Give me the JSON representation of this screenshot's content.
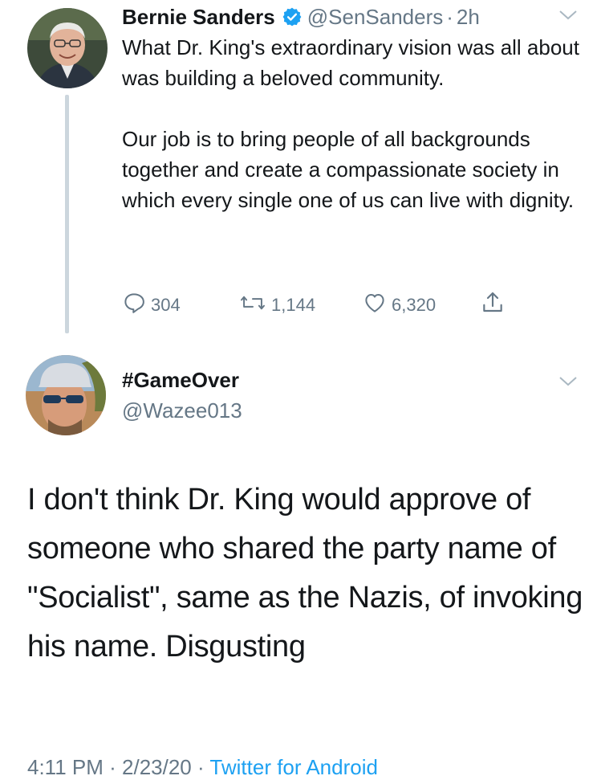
{
  "tweet1": {
    "name": "Bernie Sanders",
    "handle": "@SenSanders",
    "dot": "·",
    "time": "2h",
    "body_p1": "What Dr. King's extraordinary vision was all about was building a beloved community.",
    "body_p2": "Our job is to bring people of all backgrounds together and create a compassionate society in which every single one of us can live with dignity.",
    "replies": "304",
    "retweets": "1,144",
    "likes": "6,320"
  },
  "tweet2": {
    "name": "#GameOver",
    "handle": "@Wazee013",
    "body": "I don't think Dr. King would approve of someone who shared the party name of \"Socialist\", same as the Nazis, of invoking his name. Disgusting",
    "time": "4:11 PM",
    "dot1": " · ",
    "date": "2/23/20",
    "dot2": " · ",
    "source": "Twitter for Android"
  },
  "colors": {
    "text": "#14171a",
    "muted": "#657786",
    "accent": "#1da1f2",
    "thread_line": "#ccd6dd"
  },
  "icons": [
    "verified-badge-icon",
    "chevron-down-icon",
    "reply-icon",
    "retweet-icon",
    "like-icon",
    "share-icon"
  ]
}
